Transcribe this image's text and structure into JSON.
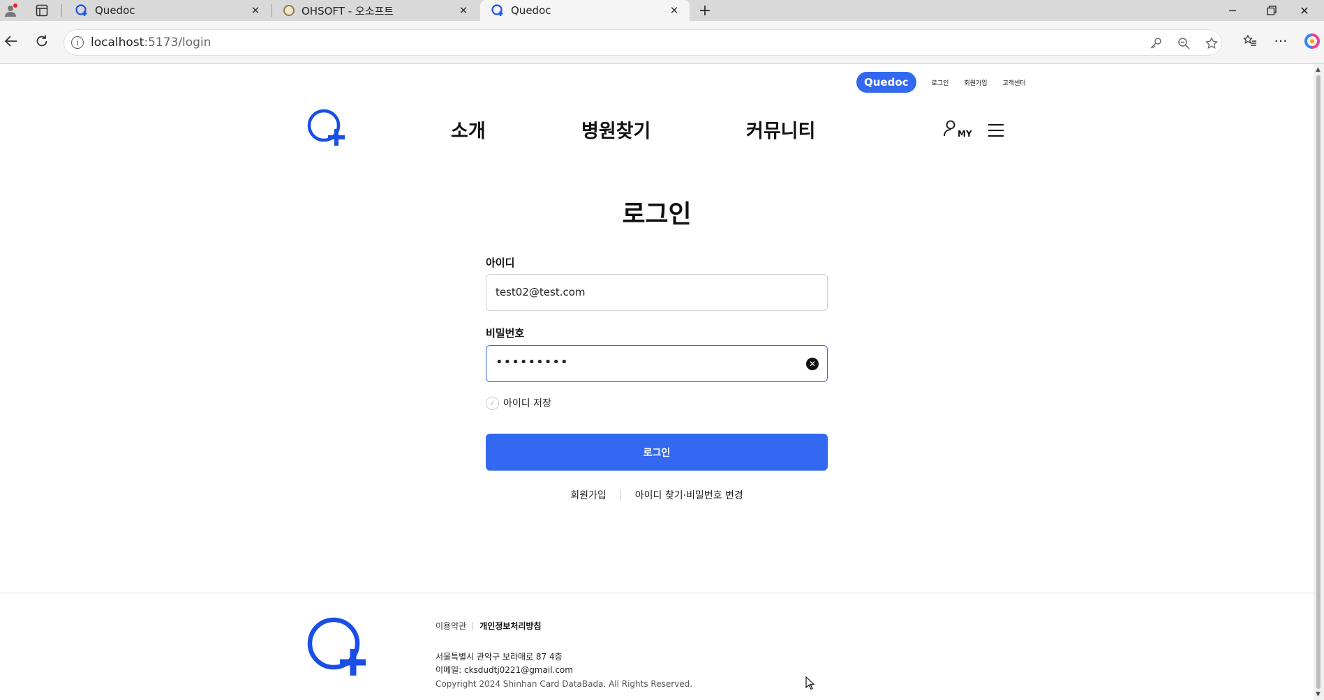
{
  "browser": {
    "tabs": [
      {
        "title": "Quedoc",
        "favicon": "quedoc-icon",
        "active": false
      },
      {
        "title": "OHSOFT - 오소프트",
        "favicon": "globe-icon",
        "active": false
      },
      {
        "title": "Quedoc",
        "favicon": "quedoc-icon",
        "active": true
      }
    ],
    "url_host": "localhost",
    "url_path": ":5173/login"
  },
  "header": {
    "util_brand": "Quedoc",
    "util_links": [
      "로그인",
      "회원가입",
      "고객센터"
    ],
    "nav": [
      "소개",
      "병원찾기",
      "커뮤니티"
    ],
    "my_label": "MY"
  },
  "login": {
    "title": "로그인",
    "id_label": "아이디",
    "id_value": "test02@test.com",
    "pw_label": "비밀번호",
    "pw_value": "•••••••••",
    "remember_label": "아이디 저장",
    "submit_label": "로그인",
    "signup_link": "회원가입",
    "find_link": "아이디 찾기·비밀번호 변경"
  },
  "footer": {
    "terms": "이용약관",
    "privacy": "개인정보처리방침",
    "address": "서울특별시 관악구 보라매로 87 4층",
    "email": "이메일: cksdudtj0221@gmail.com",
    "copyright": "Copyright 2024 Shinhan Card DataBada. All Rights Reserved."
  },
  "colors": {
    "brand": "#3369f0",
    "logo": "#1a4fe6"
  }
}
